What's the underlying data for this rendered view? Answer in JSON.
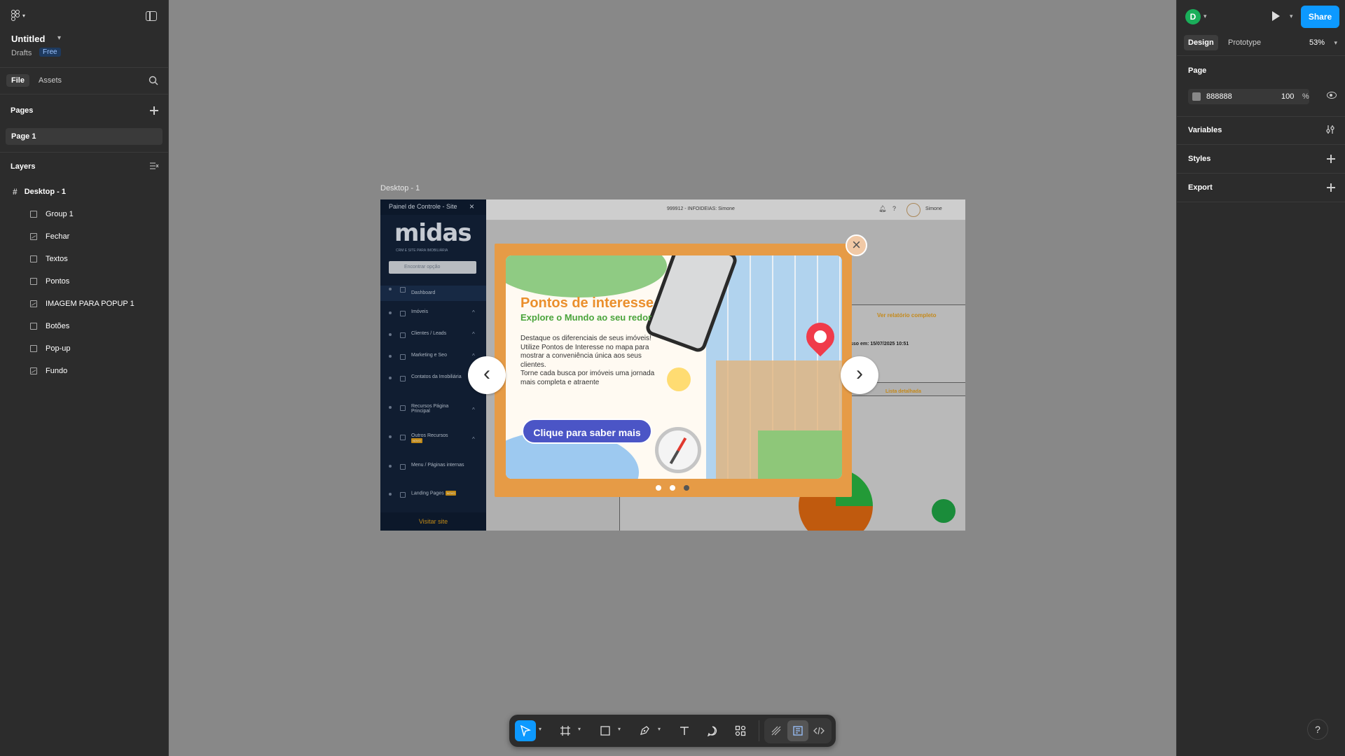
{
  "app": {
    "file_title": "Untitled",
    "location": "Drafts",
    "plan_badge": "Free"
  },
  "left_panel": {
    "tabs": [
      "File",
      "Assets"
    ],
    "pages_heading": "Pages",
    "pages": [
      "Page 1"
    ],
    "layers_heading": "Layers",
    "layers": [
      {
        "name": "Desktop - 1",
        "icon": "frame-icon"
      },
      {
        "name": "Group 1",
        "icon": "group-icon"
      },
      {
        "name": "Fechar",
        "icon": "image-icon"
      },
      {
        "name": "Textos",
        "icon": "group-icon"
      },
      {
        "name": "Pontos",
        "icon": "group-icon"
      },
      {
        "name": "IMAGEM PARA POPUP 1",
        "icon": "image-icon"
      },
      {
        "name": "Botões",
        "icon": "group-icon"
      },
      {
        "name": "Pop-up",
        "icon": "group-icon"
      },
      {
        "name": "Fundo",
        "icon": "image-icon"
      }
    ]
  },
  "right_panel": {
    "avatar_letter": "D",
    "share_label": "Share",
    "tabs": [
      "Design",
      "Prototype"
    ],
    "zoom": "53%",
    "page_heading": "Page",
    "page_fill_hex": "888888",
    "page_fill_opacity": "100",
    "page_fill_percent": "%",
    "sections": [
      "Variables",
      "Styles",
      "Export"
    ]
  },
  "canvas": {
    "background_color": "#888888",
    "frame_label": "Desktop - 1"
  },
  "frame": {
    "sidebar_header": "Painel de Controle - Site",
    "logo": "midas",
    "logo_sub": "CRM E SITE PARA IMOBILIÁRIA",
    "search_placeholder": "Encontrar opção",
    "menu": [
      {
        "label": "Dashboard"
      },
      {
        "label": "Imóveis"
      },
      {
        "label": "Clientes / Leads"
      },
      {
        "label": "Marketing e Seo"
      },
      {
        "label": "Contatos da Imobiliária"
      },
      {
        "label": "Recursos Página Principal"
      },
      {
        "label": "Outros Recursos"
      },
      {
        "label": "Menu / Páginas internas"
      },
      {
        "label": "Landing Pages"
      }
    ],
    "novo_badge": "NOVO",
    "visit_site": "Visitar site",
    "top_center": "999912 - INFOIDEIAS: Simone",
    "top_user": "Simone",
    "bg_link": "Ver relatório completo",
    "bg_card_text": "sso em: 15/07/2025 10:51",
    "bg_card_link": "Lista detalhada"
  },
  "popup": {
    "title": "Pontos de interesse",
    "subtitle": "Explore o Mundo ao seu redor",
    "body_1": "Destaque os diferenciais de seus imóveis!",
    "body_2": "Utilize Pontos de Interesse no mapa para mostrar a conveniência única aos seus clientes.",
    "body_3": "Torne cada busca por imóveis uma jornada mais completa e atraente",
    "cta": "Clique para saber mais",
    "slides": 3,
    "active_slide": 3,
    "accent_color": "#e69b46"
  },
  "toolbar": {
    "tools": [
      "move-tool",
      "frame-tool",
      "shape-tool",
      "pen-tool",
      "text-tool",
      "comment-tool",
      "actions-tool",
      "draw-mode",
      "design-mode",
      "dev-mode"
    ],
    "active_tool": "move-tool"
  },
  "help_label": "?"
}
